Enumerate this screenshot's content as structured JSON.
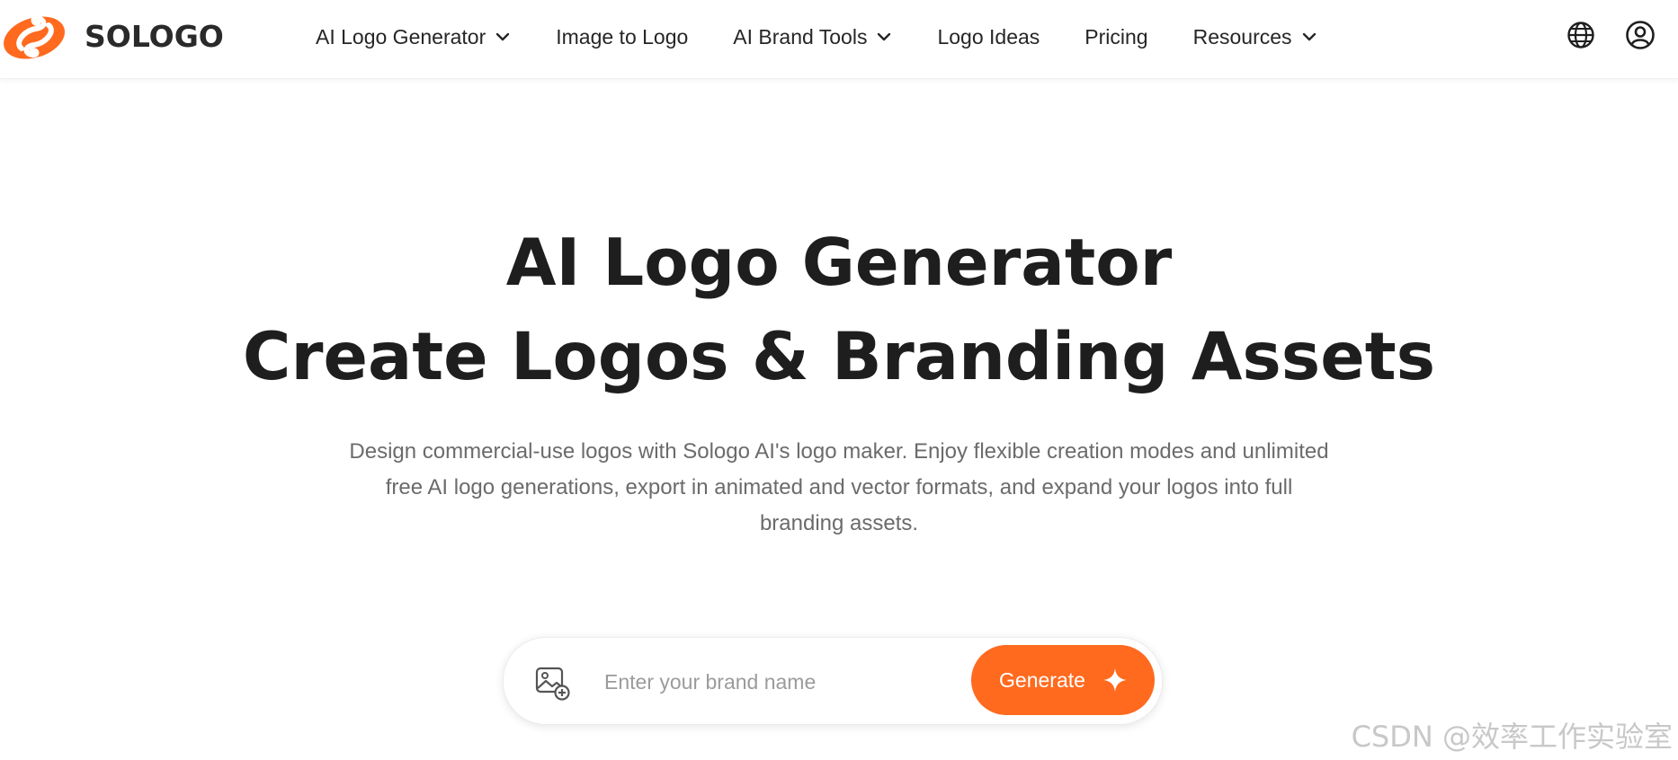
{
  "brand": {
    "name": "SOLOGO",
    "accent_color": "#ff6a1f",
    "logo_icon": "sologo-swirl-icon"
  },
  "nav": {
    "items": [
      {
        "label": "AI Logo Generator",
        "has_dropdown": true
      },
      {
        "label": "Image to Logo",
        "has_dropdown": false
      },
      {
        "label": "AI Brand Tools",
        "has_dropdown": true
      },
      {
        "label": "Logo Ideas",
        "has_dropdown": false
      },
      {
        "label": "Pricing",
        "has_dropdown": false
      },
      {
        "label": "Resources",
        "has_dropdown": true
      }
    ],
    "right_icons": [
      "globe-icon",
      "account-icon"
    ]
  },
  "hero": {
    "title_line1": "AI Logo Generator",
    "title_line2": "Create Logos & Branding Assets",
    "subtitle": "Design commercial-use logos with Sologo AI's logo maker. Enjoy flexible creation modes and unlimited free AI logo generations, export in animated and vector formats, and expand your logos into full branding assets."
  },
  "generator": {
    "upload_icon": "image-add-icon",
    "input_placeholder": "Enter your brand name",
    "input_value": "",
    "button_label": "Generate",
    "button_icon": "sparkle-icon"
  },
  "watermark": "CSDN @效率工作实验室"
}
